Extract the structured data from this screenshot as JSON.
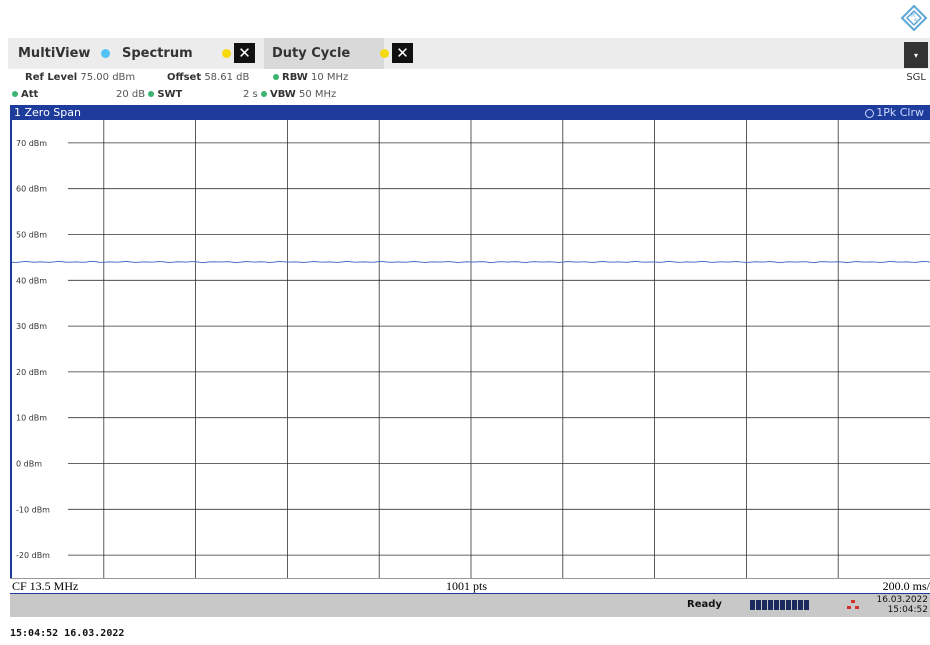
{
  "tabs": [
    {
      "label": "MultiView"
    },
    {
      "label": "Spectrum"
    },
    {
      "label": "Duty Cycle"
    }
  ],
  "close_symbol": "✕",
  "dropdown_symbol": "▾",
  "sgl": "SGL",
  "params": {
    "ref_level_label": "Ref Level",
    "ref_level_value": "75.00 dBm",
    "offset_label": "Offset",
    "offset_value": "58.61 dB",
    "rbw_label": "RBW",
    "rbw_value": "10 MHz",
    "att_label": "Att",
    "att_value": "20 dB",
    "swt_label": "SWT",
    "swt_value": "2 s",
    "vbw_label": "VBW",
    "vbw_value": "50 MHz"
  },
  "window": {
    "title": "1 Zero Span",
    "trace": "1Pk Clrw"
  },
  "chart_data": {
    "type": "line",
    "ylabel_unit": "dBm",
    "yticks": [
      70,
      60,
      50,
      40,
      30,
      20,
      10,
      0,
      -10,
      -20
    ],
    "ytick_labels": [
      "70 dBm",
      "60 dBm",
      "50 dBm",
      "40 dBm",
      "30 dBm",
      "20 dBm",
      "10 dBm",
      "0 dBm",
      "-10 dBm",
      "-20 dBm"
    ],
    "ylim": [
      -25,
      75
    ],
    "x_divisions": 10,
    "grid": true,
    "series": [
      {
        "trace_level_dbm": 44.0,
        "color": "#4a72c8"
      }
    ]
  },
  "bottom": {
    "cf": "CF 13.5 MHz",
    "pts": "1001 pts",
    "div": "200.0 ms/"
  },
  "status": {
    "ready": "Ready",
    "date": "16.03.2022",
    "time": "15:04:52"
  },
  "footer": "15:04:52  16.03.2022",
  "colors": {
    "window_bar": "#1e3c9c",
    "trace": "#4a72c8",
    "param_dot": "#3cb371",
    "tab_dot_spectrum": "#4fc3f7",
    "tab_dot_dutycycle": "#f5d90a"
  }
}
